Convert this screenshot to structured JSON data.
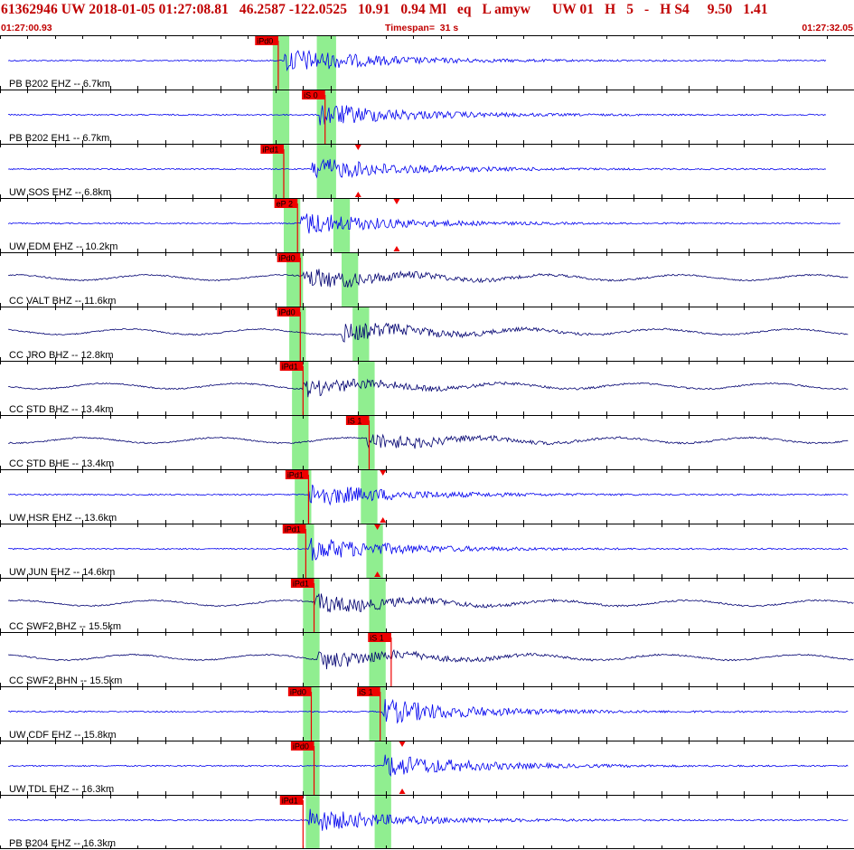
{
  "header": {
    "title": "61362946 UW 2018-01-05 01:27:08.81   46.2587 -122.0525   10.91   0.94 Ml   eq   L amyw      UW 01   H   5   -   H S4     9.50   1.41",
    "start_time": "01:27:00.93",
    "timespan": "Timespan=  31 s",
    "end_time": "01:27:32.05"
  },
  "colors": {
    "header_text": "#c00000",
    "trace_blue": "#0000ee",
    "trace_navy": "#000070",
    "pick_red": "#ee0000",
    "window_green": "#90ee90",
    "grid": "#000000"
  },
  "chart_data": {
    "type": "seismogram-stack",
    "x_unit": "s",
    "x_start_label": "01:27:00.93",
    "x_end_label": "01:27:32.05",
    "xlim_s": [
      0,
      31
    ],
    "tick_interval_s": 1,
    "channels": [
      {
        "label": "PB B202 EHZ -- 6.7km",
        "color": "blue",
        "amp": 24,
        "p_pick": {
          "label": "iPd0",
          "t": 10.1
        },
        "p_win": [
          9.9,
          10.5
        ],
        "s_win": [
          11.5,
          12.2
        ],
        "burst_t": 10.3,
        "end_t": 30.0
      },
      {
        "label": "PB B202 EH1 -- 6.7km",
        "color": "blue",
        "amp": 22,
        "s_pick": {
          "label": "iS 0",
          "t": 11.8
        },
        "p_win": [
          9.9,
          10.5
        ],
        "s_win": [
          11.5,
          12.2
        ],
        "burst_t": 11.6,
        "end_t": 30.0
      },
      {
        "label": "UW SOS EHZ -- 6.8km",
        "color": "blue",
        "amp": 22,
        "p_pick": {
          "label": "iPd1",
          "t": 10.3
        },
        "s_tri_t": 13.0,
        "p_win": [
          9.9,
          10.5
        ],
        "s_win": [
          11.5,
          12.2
        ],
        "burst_t": 11.3,
        "end_t": 30.0
      },
      {
        "label": "UW EDM EHZ -- 10.2km",
        "color": "blue",
        "amp": 22,
        "p_pick": {
          "label": "eP 2",
          "t": 10.8
        },
        "s_tri_t": 14.4,
        "p_win": [
          10.3,
          10.9
        ],
        "s_win": [
          12.1,
          12.7
        ],
        "burst_t": 10.9,
        "end_t": 30.5
      },
      {
        "label": "CC VALT BHZ -- 11.6km",
        "color": "navy",
        "amp": 20,
        "p_pick": {
          "label": "iPd0",
          "t": 10.9
        },
        "p_win": [
          10.4,
          11.0
        ],
        "s_win": [
          12.4,
          13.0
        ],
        "burst_t": 11.0,
        "end_t": 30.8
      },
      {
        "label": "CC JRO BHZ -- 12.8km",
        "color": "navy",
        "amp": 18,
        "p_pick": {
          "label": "iPd0",
          "t": 10.9
        },
        "p_win": [
          10.5,
          11.1
        ],
        "s_win": [
          12.8,
          13.4
        ],
        "burst_t": 12.4,
        "end_t": 30.8
      },
      {
        "label": "CC STD BHZ -- 13.4km",
        "color": "navy",
        "amp": 16,
        "p_pick": {
          "label": "iPd1",
          "t": 11.0
        },
        "p_win": [
          10.6,
          11.2
        ],
        "s_win": [
          13.0,
          13.6
        ],
        "burst_t": 11.0,
        "end_t": 30.8
      },
      {
        "label": "CC STD BHE -- 13.4km",
        "color": "navy",
        "amp": 16,
        "s_pick": {
          "label": "iS 1",
          "t": 13.4
        },
        "p_win": [
          10.6,
          11.2
        ],
        "s_win": [
          13.0,
          13.6
        ],
        "burst_t": 13.3,
        "end_t": 30.8
      },
      {
        "label": "UW HSR EHZ -- 13.6km",
        "color": "blue",
        "amp": 22,
        "p_pick": {
          "label": "iPd1",
          "t": 11.2
        },
        "s_tri_t": 13.9,
        "p_win": [
          10.7,
          11.3
        ],
        "s_win": [
          13.1,
          13.7
        ],
        "burst_t": 11.2,
        "end_t": 30.8
      },
      {
        "label": "UW JUN EHZ -- 14.6km",
        "color": "blue",
        "amp": 22,
        "p_pick": {
          "label": "iPd1",
          "t": 11.1
        },
        "s_tri_t": 13.7,
        "p_win": [
          10.8,
          11.4
        ],
        "s_win": [
          13.3,
          13.9
        ],
        "burst_t": 11.2,
        "end_t": 30.8
      },
      {
        "label": "CC SWF2 BHZ -- 15.5km",
        "color": "navy",
        "amp": 18,
        "p_pick": {
          "label": "iPd1",
          "t": 11.4
        },
        "p_win": [
          11.0,
          11.6
        ],
        "s_win": [
          13.4,
          14.0
        ],
        "burst_t": 11.4,
        "end_t": 31.0
      },
      {
        "label": "CC SWF2 BHN -- 15.5km",
        "color": "navy",
        "amp": 18,
        "s_pick": {
          "label": "iS 1",
          "t": 14.2
        },
        "p_win": [
          11.0,
          11.6
        ],
        "s_win": [
          13.4,
          14.0
        ],
        "burst_t": 11.5,
        "end_t": 31.0
      },
      {
        "label": "UW CDF EHZ -- 15.8km",
        "color": "blue",
        "amp": 24,
        "p_pick": {
          "label": "iPd0",
          "t": 11.3
        },
        "s_pick": {
          "label": "iS 1",
          "t": 13.8
        },
        "p_win": [
          11.0,
          11.6
        ],
        "s_win": [
          13.4,
          14.0
        ],
        "burst_t": 13.8,
        "end_t": 30.8
      },
      {
        "label": "UW TDL EHZ -- 16.3km",
        "color": "blue",
        "amp": 22,
        "p_pick": {
          "label": "iPd0",
          "t": 11.4
        },
        "s_tri_t": 14.6,
        "p_win": [
          11.0,
          11.6
        ],
        "s_win": [
          13.6,
          14.2
        ],
        "burst_t": 13.9,
        "end_t": 30.8
      },
      {
        "label": "PB B204 EHZ -- 16.3km",
        "color": "blue",
        "amp": 22,
        "p_pick": {
          "label": "iPd1",
          "t": 11.0
        },
        "p_win": [
          11.1,
          11.6
        ],
        "s_win": [
          13.6,
          14.2
        ],
        "burst_t": 11.2,
        "end_t": 30.8
      }
    ]
  }
}
